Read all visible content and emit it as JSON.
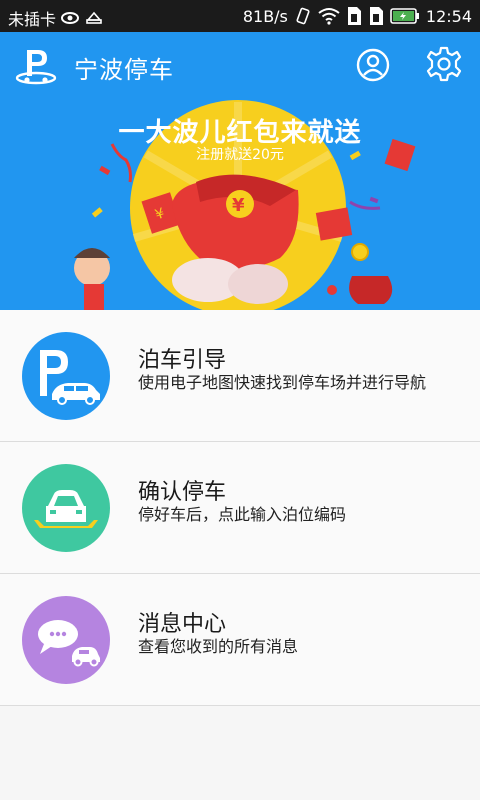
{
  "status_bar": {
    "carrier": "未插卡",
    "speed": "81B/s",
    "time": "12:54",
    "icons": [
      "eye-icon",
      "usb-icon",
      "vibrate-icon",
      "wifi-icon",
      "sim-icon",
      "sim-icon",
      "battery-icon"
    ]
  },
  "app_bar": {
    "title": "宁波停车",
    "logo_icon": "parking-logo-icon",
    "user_icon": "user-icon",
    "settings_icon": "gear-icon"
  },
  "banner": {
    "headline": "一大波儿红包来就送",
    "subline": "注册就送20元",
    "colors": {
      "background": "#2196f0",
      "sun": "#f7cf1e",
      "envelope": "#e53935"
    }
  },
  "menu": {
    "items": [
      {
        "title": "泊车引导",
        "desc": "使用电子地图快速找到停车场并进行导航",
        "icon": "parking-car-icon",
        "color": "#2196f0"
      },
      {
        "title": "确认停车",
        "desc": "停好车后，点此输入泊位编码",
        "icon": "parked-car-icon",
        "color": "#3fc8a0"
      },
      {
        "title": "消息中心",
        "desc": "查看您收到的所有消息",
        "icon": "message-car-icon",
        "color": "#b584e0"
      }
    ]
  }
}
